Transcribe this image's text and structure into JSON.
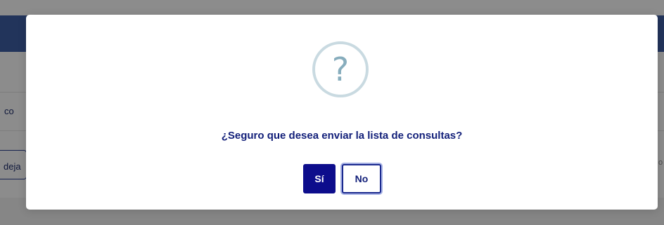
{
  "background": {
    "row_text": "co",
    "input_text": "deja",
    "right_text": "o"
  },
  "dialog": {
    "icon": "question-icon",
    "icon_glyph": "?",
    "message": "¿Seguro que desea enviar la lista de consultas?",
    "yes_label": "Sí",
    "no_label": "No"
  },
  "colors": {
    "header": "#3f5fa6",
    "primary_button": "#0d0d8c",
    "message_text": "#13207a",
    "icon_ring": "#c9dae1",
    "icon_glyph": "#87adbd"
  }
}
